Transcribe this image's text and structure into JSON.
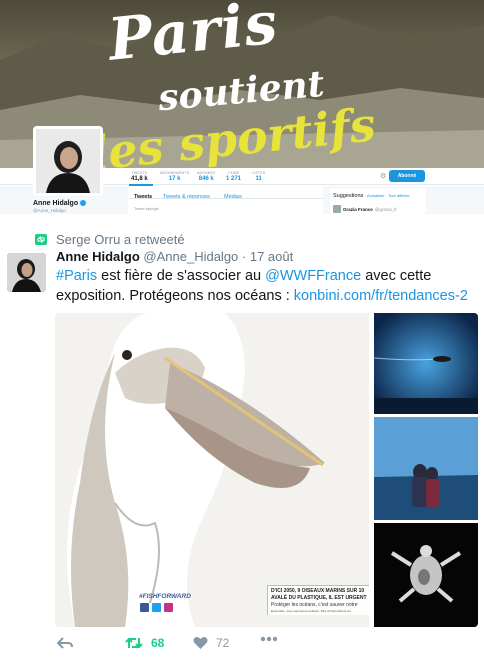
{
  "profile": {
    "banner_line1": "Paris",
    "banner_line2": "soutient",
    "banner_line3": "les sportifs",
    "name": "Anne Hidalgo",
    "handle": "@Anne_Hidalgo",
    "stats": [
      {
        "label": "TWEETS",
        "value": "41,8 k"
      },
      {
        "label": "ABONNEMENTS",
        "value": "17 k"
      },
      {
        "label": "ABONNÉS",
        "value": "846 k"
      },
      {
        "label": "J'AIME",
        "value": "1 271"
      },
      {
        "label": "LISTES",
        "value": "11"
      }
    ],
    "follow_label": "Abonné",
    "tabs": [
      "Tweets",
      "Tweets & réponses",
      "Médias"
    ],
    "pinned_label": "Tweet épinglé",
    "suggestions_title": "Suggestions",
    "suggestions_links": "· Actualiser · Tout afficher",
    "suggestion_name": "Grazia France",
    "suggestion_handle": "@grazia_fr"
  },
  "tweet": {
    "retweeted_by": "Serge Orru a retweeté",
    "author_name": "Anne Hidalgo",
    "author_handle": "@Anne_Hidalgo",
    "timestamp": "· 17 août",
    "body": {
      "hashtag": "#Paris",
      "text1": " est fière de s'associer au ",
      "mention": "@WWFFrance",
      "text2": " avec cette exposition. Protégeons nos océans : ",
      "link": "konbini.com/fr/tendances-2 …"
    },
    "media": {
      "hashtag": "#FISHFORWARD",
      "caption_line1": "D'ICI 2050, 9 OISEAUX MARINS SUR 10 ",
      "caption_line2": "AVALÉ DU PLASTIQUE, IL EST URGENT",
      "caption_line3": "Protéger les océans, c'est sauver notre",
      "caption_line4": "Ensemble, nous sommes la solution. Plus d'informations sur"
    },
    "retweet_count": "68",
    "like_count": "72"
  },
  "colors": {
    "accent": "#1b95e0",
    "retweet": "#19cf86",
    "muted": "#657786",
    "banner_yellow": "#e7e33b"
  },
  "icons": [
    "retweet-icon",
    "reply-icon",
    "like-icon",
    "more-icon",
    "verified-icon",
    "gear-icon",
    "facebook-icon",
    "twitter-icon",
    "instagram-icon"
  ]
}
